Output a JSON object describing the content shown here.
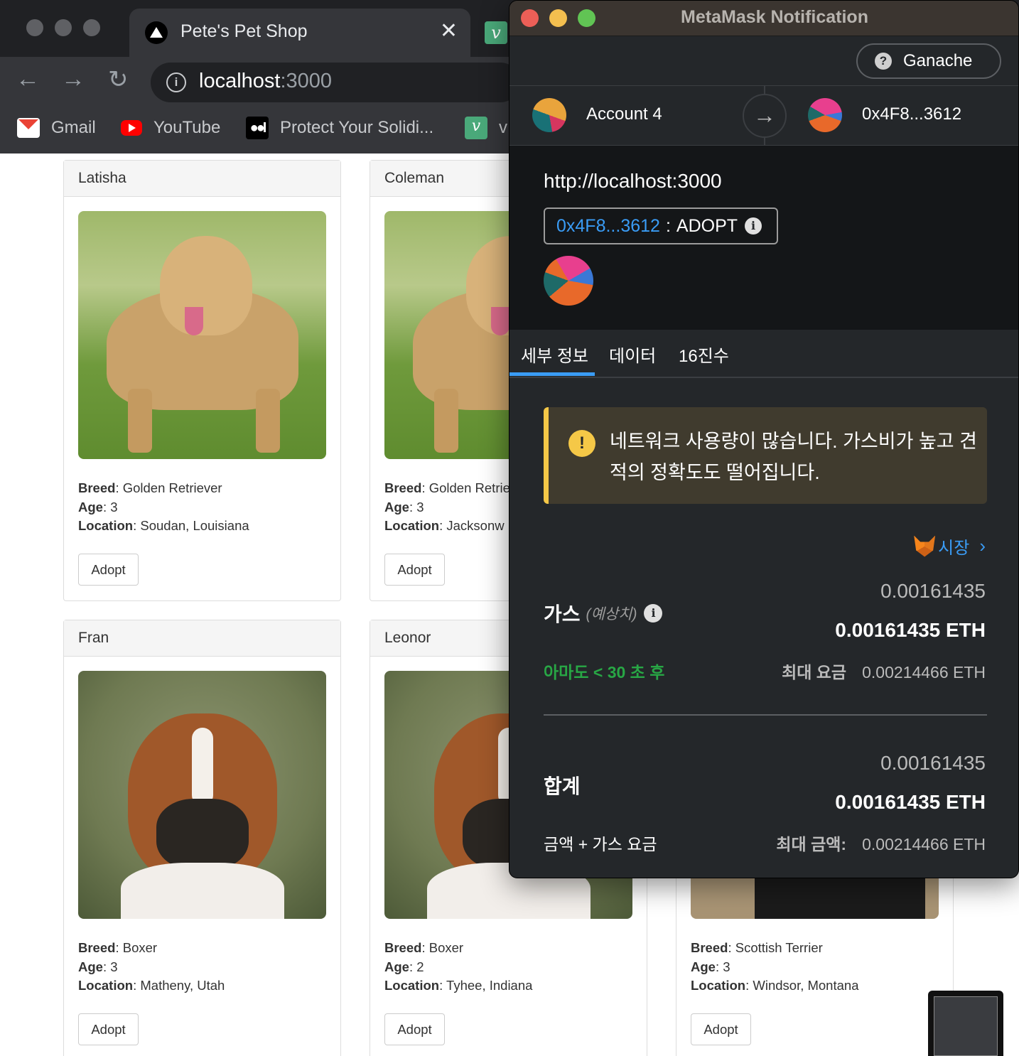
{
  "browser": {
    "tab_title": "Pete's Pet Shop",
    "tab_close": "✕",
    "tab2_icon_text": "v",
    "url_host": "localhost",
    "url_port": ":3000",
    "back_icon": "←",
    "forward_icon": "→",
    "reload_icon": "↻",
    "info_icon": "i",
    "bookmarks": [
      {
        "label": "Gmail",
        "icon": "gmail-icon"
      },
      {
        "label": "YouTube",
        "icon": "youtube-icon"
      },
      {
        "label": "Protect Your Solidi...",
        "icon": "medium-icon"
      },
      {
        "label": "v",
        "icon": "v-icon"
      }
    ],
    "medium_icon_text": "●●I"
  },
  "pets": [
    {
      "name": "Latisha",
      "breed": "Golden Retriever",
      "age": "3",
      "location": "Soudan, Louisiana",
      "image": "golden-retriever"
    },
    {
      "name": "Coleman",
      "breed": "Golden Retrie",
      "age": "3",
      "location": "Jacksonw",
      "image": "golden-retriever"
    },
    {
      "name": "Fran",
      "breed": "Boxer",
      "age": "3",
      "location": "Matheny, Utah",
      "image": "boxer"
    },
    {
      "name": "Leonor",
      "breed": "Boxer",
      "age": "2",
      "location": "Tyhee, Indiana",
      "image": "boxer"
    },
    {
      "name": "",
      "breed": "Scottish Terrier",
      "age": "3",
      "location": "Windsor, Montana",
      "image": "scottish-terrier"
    }
  ],
  "labels": {
    "breed": "Breed",
    "age": "Age",
    "location": "Location",
    "adopt": "Adopt",
    "colon": ": "
  },
  "metamask": {
    "window_title": "MetaMask Notification",
    "network": "Ganache",
    "network_icon": "?",
    "from_account": "Account 4",
    "arrow": "→",
    "to_address": "0x4F8...3612",
    "origin": "http://localhost:3000",
    "method_address": "0x4F8...3612",
    "method_sep": ":",
    "method_name": "ADOPT",
    "info_icon": "i",
    "tabs": [
      "세부 정보",
      "데이터",
      "16진수"
    ],
    "warning_icon": "!",
    "warning_text": "네트워크 사용량이 많습니다. 가스비가 높고 견적의 정확도도 떨어집니다.",
    "market_label": "시장",
    "market_chevron": "›",
    "gas_label": "가스",
    "gas_estimate_note": "(예상치)",
    "gas_fiat": "0.00161435",
    "gas_eth": "0.00161435 ETH",
    "gas_time": "아마도 < 30 초 후",
    "gas_max_label": "최대 요금",
    "gas_max_value": "0.00214466 ETH",
    "total_label": "합계",
    "total_fiat": "0.00161435",
    "total_eth": "0.00161435 ETH",
    "total_sub": "금액 + 가스 요금",
    "total_max_label": "최대 금액:",
    "total_max_value": "0.00214466 ETH",
    "colors": {
      "accent": "#3a9cf5",
      "warning": "#f5c847",
      "success": "#28a745",
      "close": "#ec5f57",
      "minimize": "#f4bf4f",
      "zoom": "#61c454"
    }
  }
}
